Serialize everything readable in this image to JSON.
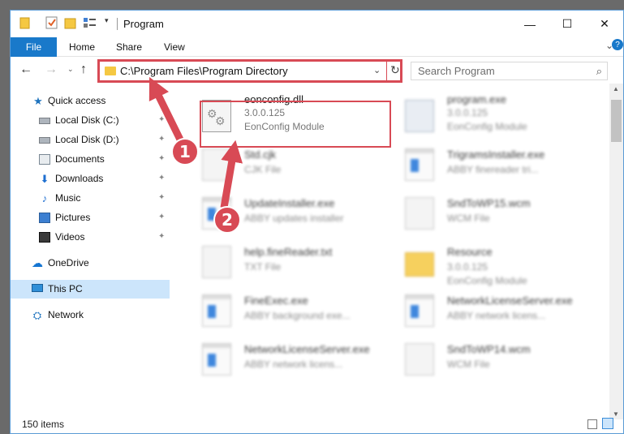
{
  "window": {
    "title": "Program",
    "minimize_glyph": "—",
    "maximize_glyph": "☐",
    "close_glyph": "✕"
  },
  "ribbon": {
    "file_label": "File",
    "home_label": "Home",
    "share_label": "Share",
    "view_label": "View",
    "expand_glyph": "⌄",
    "help_glyph": "?"
  },
  "navigation": {
    "back_glyph": "←",
    "forward_glyph": "→",
    "recent_glyph": "⌄",
    "up_glyph": "↑",
    "address": "C:\\Program Files\\Program Directory",
    "address_dropdown_glyph": "⌄",
    "refresh_glyph": "↻",
    "search_placeholder": "Search Program",
    "search_glyph": "⌕"
  },
  "sidebar": {
    "items": [
      {
        "label": "Quick access",
        "icon": "star-icon",
        "pinned": false
      },
      {
        "label": "Local Disk (C:)",
        "icon": "drive-icon",
        "pinned": true
      },
      {
        "label": "Local Disk (D:)",
        "icon": "drive-icon",
        "pinned": true
      },
      {
        "label": "Documents",
        "icon": "documents-icon",
        "pinned": true
      },
      {
        "label": "Downloads",
        "icon": "download-icon",
        "pinned": true
      },
      {
        "label": "Music",
        "icon": "music-icon",
        "pinned": true
      },
      {
        "label": "Pictures",
        "icon": "pictures-icon",
        "pinned": true
      },
      {
        "label": "Videos",
        "icon": "videos-icon",
        "pinned": true
      },
      {
        "label": "OneDrive",
        "icon": "cloud-icon",
        "pinned": false
      },
      {
        "label": "This PC",
        "icon": "computer-icon",
        "pinned": false,
        "selected": true
      },
      {
        "label": "Network",
        "icon": "network-icon",
        "pinned": false
      }
    ],
    "pin_glyph": "📌"
  },
  "files": [
    {
      "name": "eonconfig.dll",
      "line1": "3.0.0.125",
      "line2": "EonConfig Module",
      "icon": "dll-icon",
      "highlighted": true
    },
    {
      "name": "program.exe",
      "line1": "3.0.0.125",
      "line2": "EonConfig Module",
      "icon": "application-icon"
    },
    {
      "name": "Std.cjk",
      "line1": "CJK File",
      "icon": "document-icon"
    },
    {
      "name": "TrigramsInstaller.exe",
      "line1": "ABBY finereader tri...",
      "icon": "exe-icon"
    },
    {
      "name": "UpdateInstaller.exe",
      "line1": "ABBY updates installer",
      "icon": "exe-icon"
    },
    {
      "name": "SndToWP15.wcm",
      "line1": "WCM File",
      "icon": "document-icon"
    },
    {
      "name": "help.fineReader.txt",
      "line1": "TXT File",
      "icon": "document-icon"
    },
    {
      "name": "Resource",
      "line1": "3.0.0.125",
      "line2": "EonConfig Module",
      "icon": "folder-icon"
    },
    {
      "name": "FineExec.exe",
      "line1": "ABBY background exe...",
      "icon": "exe-icon"
    },
    {
      "name": "NetworkLicenseServer.exe",
      "line1": "ABBY network licens...",
      "icon": "exe-icon"
    },
    {
      "name": "NetworkLicenseServer.exe",
      "line1": "ABBY network licens...",
      "icon": "exe-icon"
    },
    {
      "name": "SndToWP14.wcm",
      "line1": "WCM File",
      "icon": "document-icon"
    }
  ],
  "status": {
    "item_count": "150 items"
  },
  "annotations": {
    "step1": "1",
    "step2": "2",
    "accent": "#d84a55"
  }
}
